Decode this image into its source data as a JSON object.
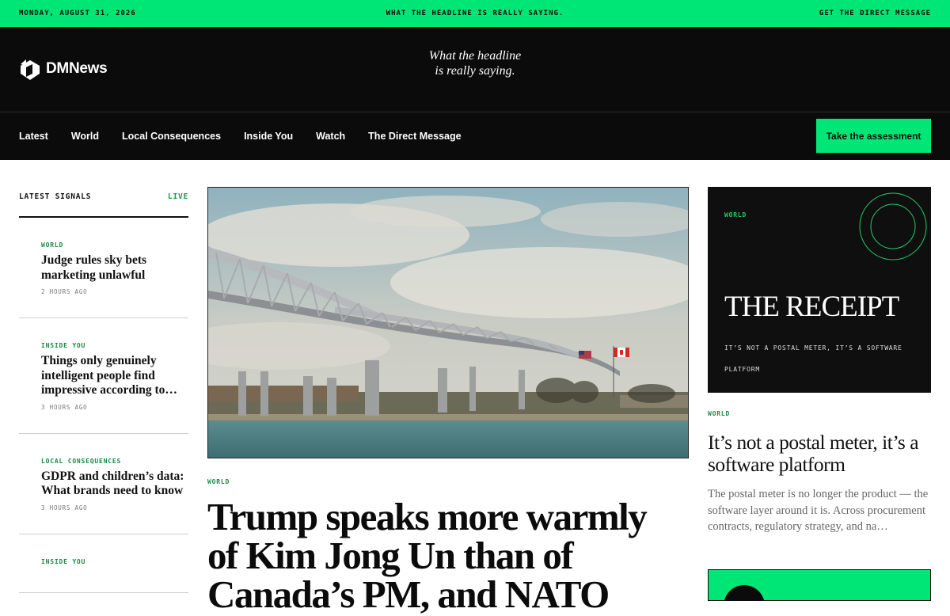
{
  "topbar": {
    "date": "MONDAY, AUGUST 31, 2026",
    "slogan": "WHAT THE HEADLINE IS REALLY SAYING.",
    "link": "GET THE DIRECT MESSAGE"
  },
  "masthead": {
    "brand": "DMNews",
    "tagline_line1": "What the headline",
    "tagline_line2": "is really saying."
  },
  "nav": {
    "items": [
      "Latest",
      "World",
      "Local Consequences",
      "Inside You",
      "Watch",
      "The Direct Message"
    ],
    "cta": "Take the assessment"
  },
  "signals": {
    "title": "LATEST SIGNALS",
    "live": "LIVE",
    "items": [
      {
        "category": "WORLD",
        "title": "Judge rules sky bets marketing unlawful",
        "time": "2 HOURS AGO"
      },
      {
        "category": "INSIDE YOU",
        "title": "Things only genuinely intelligent people find impressive according to…",
        "time": "3 HOURS AGO"
      },
      {
        "category": "LOCAL CONSEQUENCES",
        "title": "GDPR and children’s data: What brands need to know",
        "time": "3 HOURS AGO"
      },
      {
        "category": "INSIDE YOU",
        "title": "",
        "time": ""
      }
    ]
  },
  "lead": {
    "category": "WORLD",
    "title": "Trump speaks more warmly of Kim Jong Un than of Canada’s PM, and NATO"
  },
  "promo": {
    "category": "WORLD",
    "headline": "THE RECEIPT",
    "subline": "IT’S NOT A POSTAL METER, IT’S A SOFTWARE PLATFORM"
  },
  "side_story": {
    "category": "WORLD",
    "title": "It’s not a postal meter, it’s a software platform",
    "excerpt": "The postal meter is no longer the product — the software layer around it is. Across procurement contracts, regulatory strategy, and na…"
  },
  "colors": {
    "accent": "#00e676",
    "dark": "#0b0b0b",
    "category_green": "#1a8a44"
  }
}
